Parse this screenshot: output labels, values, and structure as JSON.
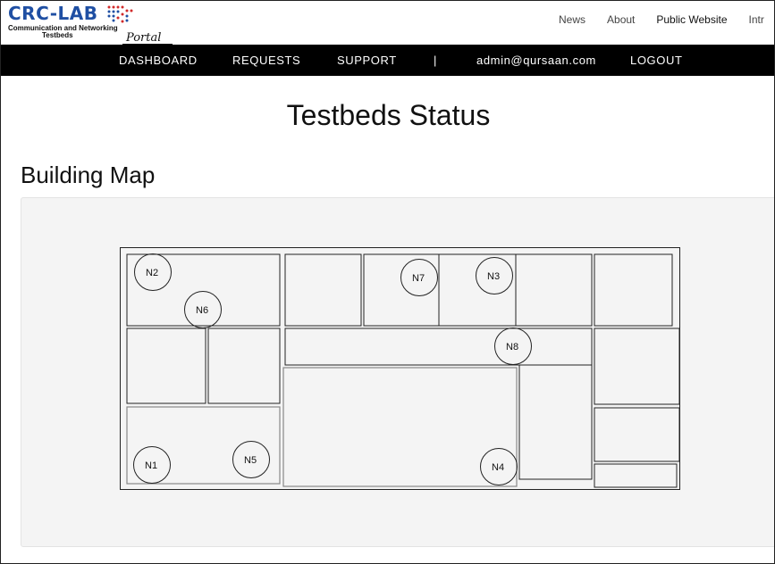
{
  "logo": {
    "main": "CRC-LAB",
    "line1": "Communication and Networking",
    "line2": "Testbeds",
    "portal": "Portal"
  },
  "top_links": [
    "News",
    "About",
    "Public Website",
    "Intr"
  ],
  "nav": {
    "dashboard": "DASHBOARD",
    "requests": "REQUESTS",
    "support": "SUPPORT",
    "separator": "|",
    "user": "admin@qursaan.com",
    "logout": "LOGOUT"
  },
  "page_title": "Testbeds Status",
  "section_title": "Building Map",
  "nodes": [
    {
      "id": "n1",
      "label": "N1"
    },
    {
      "id": "n2",
      "label": "N2"
    },
    {
      "id": "n3",
      "label": "N3"
    },
    {
      "id": "n4",
      "label": "N4"
    },
    {
      "id": "n5",
      "label": "N5"
    },
    {
      "id": "n6",
      "label": "N6"
    },
    {
      "id": "n7",
      "label": "N7"
    },
    {
      "id": "n8",
      "label": "N8"
    }
  ],
  "colors": {
    "logo_blue": "#1f4fa3",
    "logo_red": "#d12a2a",
    "navbar": "#000000",
    "panel": "#f4f4f4"
  }
}
